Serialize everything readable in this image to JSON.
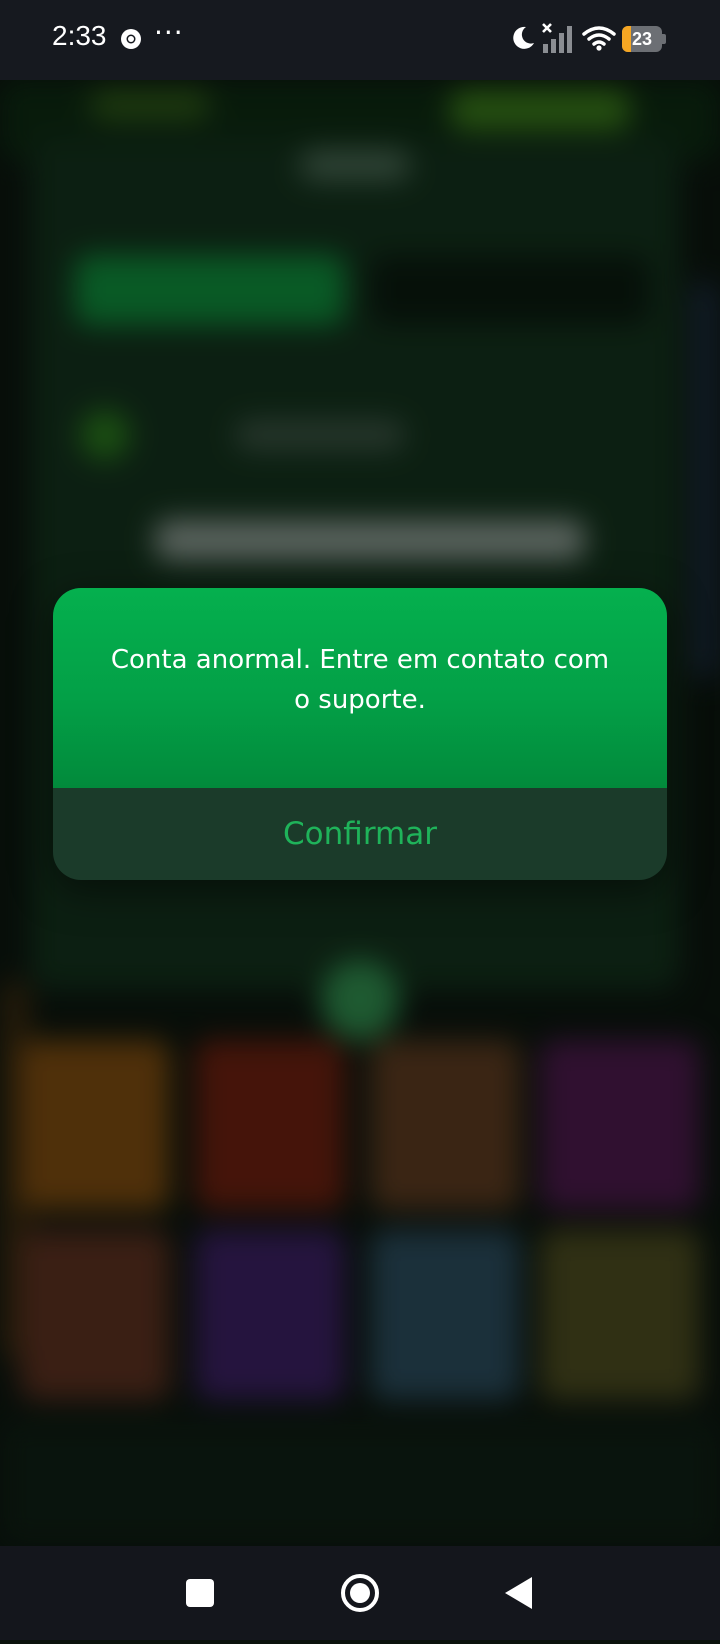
{
  "status_bar": {
    "time": "2:33",
    "more": "···",
    "battery_level": "23",
    "battery_fraction": 0.23,
    "battery_color": "#f5a623",
    "icons": [
      "chrome-icon",
      "moon-icon",
      "signal-icon",
      "wifi-icon",
      "battery-icon"
    ]
  },
  "dialog": {
    "message": "Conta anormal. Entre em contato com o suporte.",
    "confirm_label": "Confirmar",
    "accent": "#05b04e",
    "button_text_color": "#1fb35a"
  },
  "nav_bar": {
    "icons": [
      "recents-icon",
      "home-icon",
      "back-icon"
    ]
  }
}
